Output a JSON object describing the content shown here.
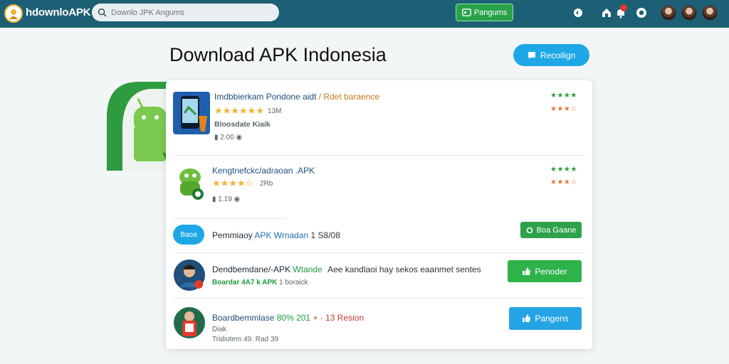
{
  "header": {
    "site_name": "hdownloAPK",
    "search_placeholder": "Downlo JPK Angums",
    "register_label": "Pangums",
    "avatars": [
      "user-1",
      "user-2",
      "user-3"
    ]
  },
  "main": {
    "title": "Download APK Indonesia",
    "recommend_label": "Recoilign"
  },
  "apps": [
    {
      "name": "Imdbbierkam Pondone aidt",
      "name_extra": "/ Rdet baraence",
      "rating_count": "13M",
      "tag": "Bloosdate Kiaik",
      "downloads": "2.00",
      "stars_top": "★★★★",
      "stars_bottom": "★★★☆"
    },
    {
      "name": "Kengtnefckc/adraoan .APK",
      "rating_count": "2Rb",
      "downloads": "1.19",
      "stars_top": "★★★★",
      "stars_bottom": "★★★☆"
    },
    {
      "badge": "Baoa",
      "name": "Pemmiaoy",
      "name_green": "APK Wrnadan",
      "size": "1 S8/08",
      "button": "Boa Gaane"
    },
    {
      "name": "Dendbemdane/-APK",
      "name_green": "Wtande",
      "desc": "Aee kandlaoi hay sekos eaanmet sentes",
      "sub": "Boardar 4A7 k APK",
      "sub_extra": "1 boraick",
      "button": "Penoder"
    },
    {
      "name": "Boardbemmlase",
      "name_green": "80% 201",
      "name_extra": "+ · 13 Resion",
      "line2": "Diak",
      "line3": "Tridiotem 49. Rad 39",
      "button": "Pangens"
    }
  ],
  "colors": {
    "topbar": "#1d5f74",
    "accent_blue": "#1ea7e6",
    "accent_green": "#28a24a",
    "star": "#f2b233"
  }
}
